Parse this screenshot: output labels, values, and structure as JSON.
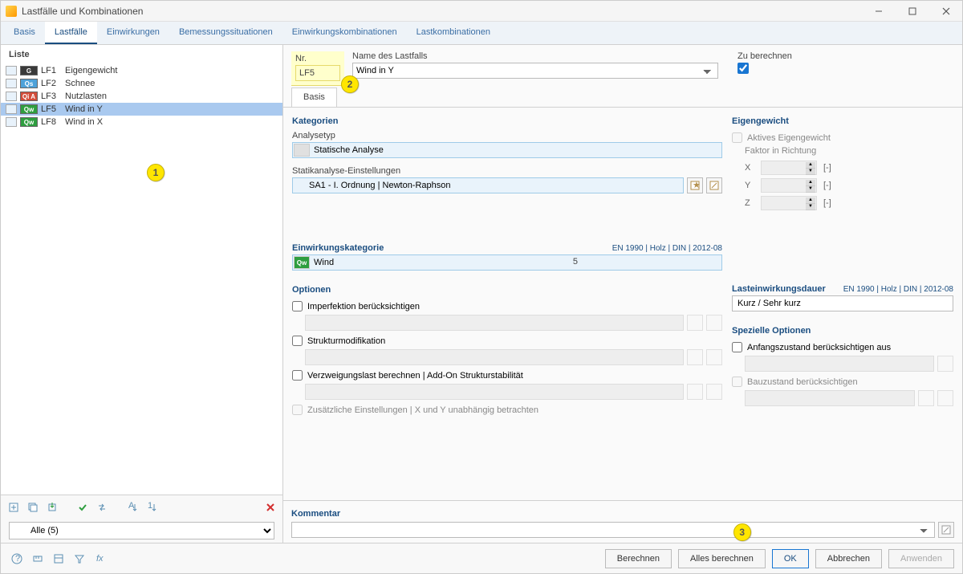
{
  "window": {
    "title": "Lastfälle und Kombinationen"
  },
  "tabs": {
    "items": [
      "Basis",
      "Lastfälle",
      "Einwirkungen",
      "Bemessungssituationen",
      "Einwirkungskombinationen",
      "Lastkombinationen"
    ],
    "active": 1
  },
  "list": {
    "header": "Liste",
    "items": [
      {
        "badge": "G",
        "badge_bg": "#3a3a3a",
        "num": "LF1",
        "name": "Eigengewicht",
        "swatch": "#e8f2fb"
      },
      {
        "badge": "Qs",
        "badge_bg": "#4fa2d9",
        "num": "LF2",
        "name": "Schnee",
        "swatch": "#e8f2fb"
      },
      {
        "badge": "Qi A",
        "badge_bg": "#d24d3a",
        "num": "LF3",
        "name": "Nutzlasten",
        "swatch": "#e8f2fb"
      },
      {
        "badge": "Qw",
        "badge_bg": "#2e9e3f",
        "num": "LF5",
        "name": "Wind in Y",
        "swatch": "#e8f2fb",
        "selected": true
      },
      {
        "badge": "Qw",
        "badge_bg": "#2e9e3f",
        "num": "LF8",
        "name": "Wind in X",
        "swatch": "#e8f2fb"
      }
    ],
    "filter": "Alle (5)"
  },
  "annotations": {
    "b1": "1",
    "b2": "2",
    "b3": "3"
  },
  "header_fields": {
    "nr_label": "Nr.",
    "nr_value": "LF5",
    "name_label": "Name des Lastfalls",
    "name_value": "Wind in Y",
    "calc_label": "Zu berechnen",
    "calc_checked": true
  },
  "subtab": {
    "label": "Basis"
  },
  "form": {
    "kategorien_title": "Kategorien",
    "analysetyp_label": "Analysetyp",
    "analysetyp_value": "Statische Analyse",
    "statik_label": "Statikanalyse-Einstellungen",
    "statik_value": "SA1 - I. Ordnung | Newton-Raphson",
    "einw_title": "Einwirkungskategorie",
    "einw_meta": "EN 1990 | Holz | DIN | 2012-08",
    "einw_badge": "Qw",
    "einw_value": "Wind",
    "einw_kled": "5",
    "opt_title": "Optionen",
    "opt1": "Imperfektion berücksichtigen",
    "opt2": "Strukturmodifikation",
    "opt3": "Verzweigungslast berechnen | Add-On Strukturstabilität",
    "opt4": "Zusätzliche Einstellungen | X und Y unabhängig betrachten",
    "kommentar_title": "Kommentar"
  },
  "right": {
    "eg_title": "Eigengewicht",
    "eg_active": "Aktives Eigengewicht",
    "eg_factor_label": "Faktor in Richtung",
    "axes": [
      "X",
      "Y",
      "Z"
    ],
    "unit": "[-]",
    "last_title": "Lasteinwirkungsdauer",
    "last_meta": "EN 1990 | Holz | DIN | 2012-08",
    "last_value": "Kurz / Sehr kurz",
    "spec_title": "Spezielle Optionen",
    "spec1": "Anfangszustand berücksichtigen aus",
    "spec2": "Bauzustand berücksichtigen"
  },
  "footer": {
    "berechnen": "Berechnen",
    "alles": "Alles berechnen",
    "ok": "OK",
    "abbrechen": "Abbrechen",
    "anwenden": "Anwenden"
  }
}
